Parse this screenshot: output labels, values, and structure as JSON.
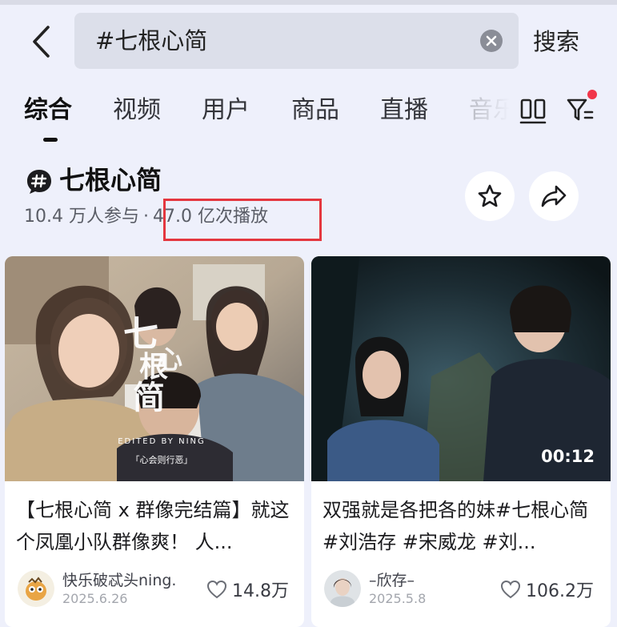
{
  "search": {
    "query": "#七根心简",
    "button_label": "搜索"
  },
  "tabs": [
    {
      "label": "综合",
      "active": true
    },
    {
      "label": "视频"
    },
    {
      "label": "用户"
    },
    {
      "label": "商品"
    },
    {
      "label": "直播"
    },
    {
      "label": "音乐"
    }
  ],
  "topic": {
    "title": "七根心简",
    "participants": "10.4 万人参与",
    "separator": "·",
    "plays": "47.0 亿次播放"
  },
  "colors": {
    "highlight": "#e4373f",
    "notify_dot": "#f1364a",
    "background": "#eef0fb"
  },
  "cards": [
    {
      "title": "【七根心简 x 群像完结篇】就这个凤凰小队群像爽！ 人...",
      "author": "快乐破忒头ning.",
      "date": "2025.6.26",
      "likes": "14.8万",
      "thumb_caption": "EDITED BY NING",
      "thumb_tagline": "「心会则行恶」",
      "thumb_overlay_title": "七根心简"
    },
    {
      "title": "双强就是各把各的妹#七根心简 #刘浩存 #宋威龙 #刘...",
      "author": "–欣存–",
      "date": "2025.5.8",
      "likes": "106.2万",
      "duration": "00:12"
    }
  ],
  "icons": [
    "back-arrow-icon",
    "clear-icon",
    "layout-icon",
    "filter-icon",
    "hashtag-icon",
    "star-icon",
    "share-icon",
    "heart-icon"
  ]
}
